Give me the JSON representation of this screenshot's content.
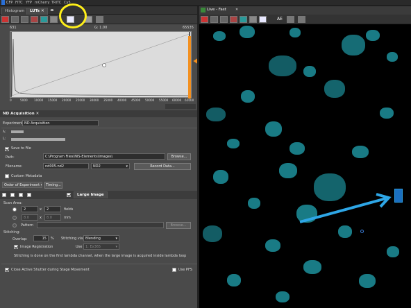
{
  "menubar": {
    "items": [
      "CFP",
      "FITC",
      "YFP",
      "mCherry",
      "TRITC",
      "Cy5"
    ]
  },
  "left_tabs": {
    "histogram": "Histogram",
    "luts": "LUTs"
  },
  "luts": {
    "min": "631",
    "max": "65535",
    "gamma": "G: 1.00",
    "x_ticks": [
      "0",
      "5000",
      "10000",
      "15000",
      "20000",
      "25000",
      "30000",
      "35000",
      "40000",
      "45000",
      "50000",
      "55000",
      "60000",
      "65000"
    ]
  },
  "nd": {
    "title": "ND Acquisition",
    "experiment_label": "Experiment:",
    "experiment_value": "ND Acquisition",
    "lambda_label": "λ:",
    "L_label": "L:",
    "save_to_file": "Save to File",
    "path_label": "Path:",
    "path_value": "C:\\Program Files\\NIS-Elements\\images\\",
    "browse": "Browse...",
    "filename_label": "Filename:",
    "filename_value": "nd005.nd2",
    "format": "ND2",
    "record_data": "Record Data...",
    "custom_metadata": "Custom Metadata",
    "order": "Order of Experiment",
    "timing": "Timing...",
    "large_image": "Large Image",
    "scan_area": "Scan Area:",
    "fields_x": "2",
    "fields_y": "2",
    "fields_label": "fields",
    "mm_x": "8.0",
    "mm_y": "8.0",
    "mm_label": "mm",
    "pattern": "Pattern",
    "browse2": "Browse...",
    "stitching": "Stitching:",
    "overlap_label": "Overlap:",
    "overlap_value": "15",
    "pct": "%",
    "stitching_via": "Stitching via:",
    "blending": "Blending",
    "image_registration": "Image Registration",
    "use_label": "Use",
    "use_value": "1: Ex365",
    "note": "Stitching is done on the first lambda channel, when the large image is acquired inside lambda loop",
    "close_shutter": "Close Active Shutter during Stage Movement",
    "use_pfs": "Use PFS"
  },
  "live": {
    "title": "Live - Fast",
    "ae": "AE"
  },
  "colors": {
    "annotation_yellow": "#ffef1a",
    "annotation_orange": "#f39020",
    "annotation_blue": "#2ea6e6",
    "cells": "#1f9aa6"
  }
}
